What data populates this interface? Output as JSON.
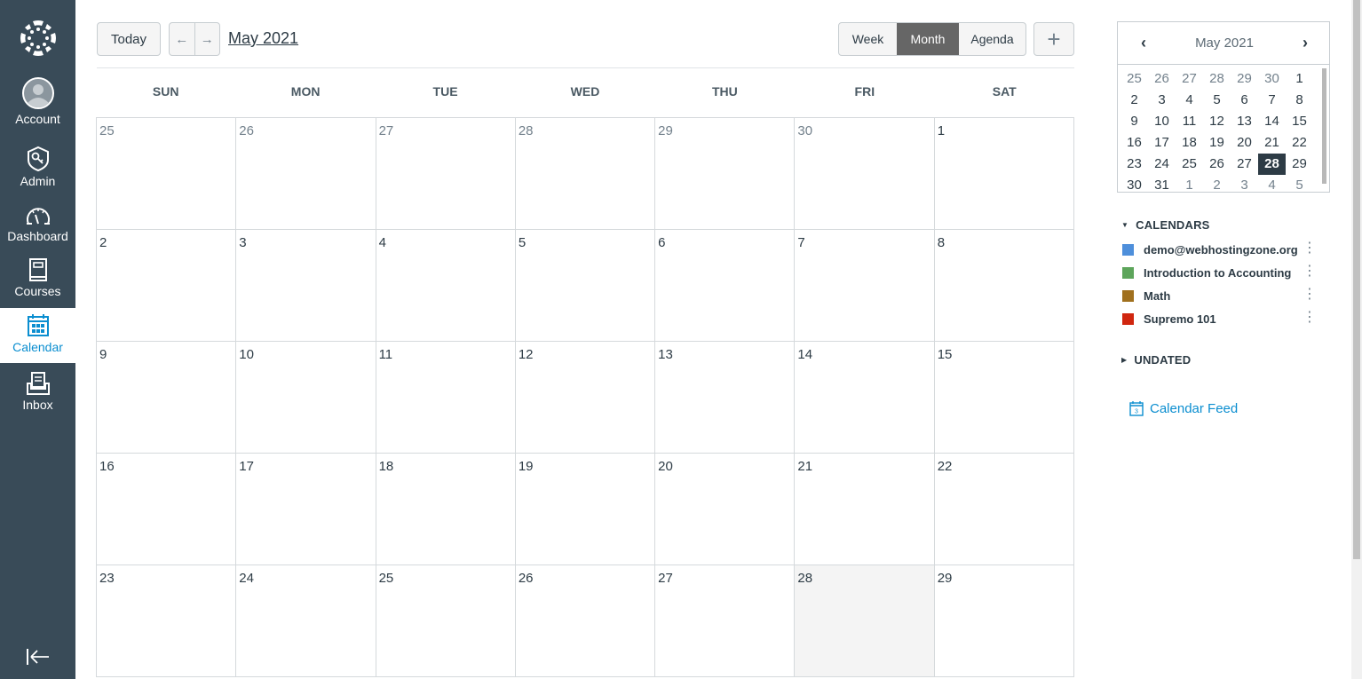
{
  "global_nav": {
    "logo_icon": "canvas-logo-icon",
    "items": [
      {
        "label": "Account",
        "icon": "avatar-icon",
        "active": false
      },
      {
        "label": "Admin",
        "icon": "shield-key-icon",
        "active": false
      },
      {
        "label": "Dashboard",
        "icon": "speedometer-icon",
        "active": false
      },
      {
        "label": "Courses",
        "icon": "book-icon",
        "active": false
      },
      {
        "label": "Calendar",
        "icon": "calendar-icon",
        "active": true
      },
      {
        "label": "Inbox",
        "icon": "inbox-icon",
        "active": false
      }
    ],
    "collapse_icon": "collapse-arrow-icon"
  },
  "header": {
    "today_label": "Today",
    "prev_arrow": "←",
    "next_arrow": "→",
    "title": "May 2021",
    "views": [
      {
        "label": "Week",
        "active": false
      },
      {
        "label": "Month",
        "active": true
      },
      {
        "label": "Agenda",
        "active": false
      }
    ],
    "add_label": "+"
  },
  "calendar": {
    "weekdays": [
      "SUN",
      "MON",
      "TUE",
      "WED",
      "THU",
      "FRI",
      "SAT"
    ],
    "weeks": [
      [
        {
          "d": "25",
          "o": true
        },
        {
          "d": "26",
          "o": true
        },
        {
          "d": "27",
          "o": true
        },
        {
          "d": "28",
          "o": true
        },
        {
          "d": "29",
          "o": true
        },
        {
          "d": "30",
          "o": true
        },
        {
          "d": "1",
          "o": false
        }
      ],
      [
        {
          "d": "2"
        },
        {
          "d": "3"
        },
        {
          "d": "4"
        },
        {
          "d": "5"
        },
        {
          "d": "6"
        },
        {
          "d": "7"
        },
        {
          "d": "8"
        }
      ],
      [
        {
          "d": "9"
        },
        {
          "d": "10"
        },
        {
          "d": "11"
        },
        {
          "d": "12"
        },
        {
          "d": "13"
        },
        {
          "d": "14"
        },
        {
          "d": "15"
        }
      ],
      [
        {
          "d": "16"
        },
        {
          "d": "17"
        },
        {
          "d": "18"
        },
        {
          "d": "19"
        },
        {
          "d": "20"
        },
        {
          "d": "21"
        },
        {
          "d": "22"
        }
      ],
      [
        {
          "d": "23"
        },
        {
          "d": "24"
        },
        {
          "d": "25"
        },
        {
          "d": "26"
        },
        {
          "d": "27"
        },
        {
          "d": "28",
          "today": true
        },
        {
          "d": "29"
        }
      ]
    ]
  },
  "minical": {
    "prev_icon": "‹",
    "next_icon": "›",
    "title": "May 2021",
    "weeks": [
      [
        {
          "d": "25",
          "o": true
        },
        {
          "d": "26",
          "o": true
        },
        {
          "d": "27",
          "o": true
        },
        {
          "d": "28",
          "o": true
        },
        {
          "d": "29",
          "o": true
        },
        {
          "d": "30",
          "o": true
        },
        {
          "d": "1"
        }
      ],
      [
        {
          "d": "2"
        },
        {
          "d": "3"
        },
        {
          "d": "4"
        },
        {
          "d": "5"
        },
        {
          "d": "6"
        },
        {
          "d": "7"
        },
        {
          "d": "8"
        }
      ],
      [
        {
          "d": "9"
        },
        {
          "d": "10"
        },
        {
          "d": "11"
        },
        {
          "d": "12"
        },
        {
          "d": "13"
        },
        {
          "d": "14"
        },
        {
          "d": "15"
        }
      ],
      [
        {
          "d": "16"
        },
        {
          "d": "17"
        },
        {
          "d": "18"
        },
        {
          "d": "19"
        },
        {
          "d": "20"
        },
        {
          "d": "21"
        },
        {
          "d": "22"
        }
      ],
      [
        {
          "d": "23"
        },
        {
          "d": "24"
        },
        {
          "d": "25"
        },
        {
          "d": "26"
        },
        {
          "d": "27"
        },
        {
          "d": "28",
          "sel": true
        },
        {
          "d": "29"
        }
      ],
      [
        {
          "d": "30"
        },
        {
          "d": "31"
        },
        {
          "d": "1",
          "o": true
        },
        {
          "d": "2",
          "o": true
        },
        {
          "d": "3",
          "o": true
        },
        {
          "d": "4",
          "o": true
        },
        {
          "d": "5",
          "o": true
        }
      ]
    ]
  },
  "sidebar": {
    "calendars_heading": "CALENDARS",
    "calendars": [
      {
        "name": "demo@webhostingzone.org",
        "color": "#4e8fdb"
      },
      {
        "name": "Introduction to Accounting",
        "color": "#5da55b"
      },
      {
        "name": "Math",
        "color": "#a0701e"
      },
      {
        "name": "Supremo 101",
        "color": "#d0260f"
      }
    ],
    "undated_heading": "UNDATED",
    "feed_label": "Calendar Feed",
    "feed_icon": "calendar-feed-icon"
  },
  "colors": {
    "nav_bg": "#394b58",
    "accent": "#0b8ed0",
    "active_view_bg": "#666666",
    "today_cell_bg": "#f4f4f4"
  }
}
